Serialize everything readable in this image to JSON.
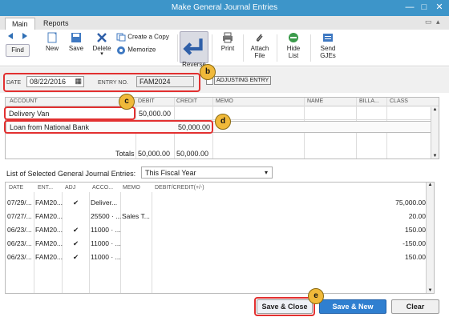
{
  "window": {
    "title": "Make General Journal Entries",
    "ctrl_min": "—",
    "ctrl_max": "□",
    "ctrl_close": "✕"
  },
  "tabs": [
    {
      "label": "Main"
    },
    {
      "label": "Reports"
    }
  ],
  "toolbar": {
    "find": "Find",
    "new": "New",
    "save": "Save",
    "delete": "Delete",
    "create_copy": "Create a Copy",
    "memorize": "Memorize",
    "reverse": "Reverse",
    "print": "Print",
    "attach_line1": "Attach",
    "attach_line2": "File",
    "hide_line1": "Hide",
    "hide_line2": "List",
    "send_line1": "Send",
    "send_line2": "GJEs"
  },
  "header": {
    "date_label": "DATE",
    "date_value": "08/22/2016",
    "entry_no_label": "ENTRY NO.",
    "entry_no_value": "FAM2024",
    "adjusting_label": "ADJUSTING ENTRY"
  },
  "callouts": {
    "b": "b",
    "c": "c",
    "d": "d",
    "e": "e"
  },
  "grid": {
    "columns": [
      "ACCOUNT",
      "DEBIT",
      "CREDIT",
      "MEMO",
      "NAME",
      "BILLA...",
      "CLASS"
    ],
    "rows": [
      {
        "account": "Delivery Van",
        "debit": "50,000.00",
        "credit": ""
      },
      {
        "account": "Loan from National Bank",
        "debit": "",
        "credit": "50,000.00"
      }
    ],
    "totals_label": "Totals",
    "total_debit": "50,000.00",
    "total_credit": "50,000.00"
  },
  "list": {
    "label": "List of Selected General Journal Entries:",
    "filter": "This Fiscal Year",
    "columns": [
      "DATE",
      "ENT...",
      "ADJ",
      "ACCO...",
      "MEMO",
      "DEBIT/CREDIT(+/-)"
    ],
    "rows": [
      {
        "date": "07/29/...",
        "ent": "FAM20...",
        "adj": "✔",
        "acct": "Deliver...",
        "memo": "",
        "amount": "75,000.00"
      },
      {
        "date": "07/27/...",
        "ent": "FAM20...",
        "adj": "",
        "acct": "25500 · ...",
        "memo": "Sales T...",
        "amount": "20.00"
      },
      {
        "date": "06/23/...",
        "ent": "FAM20...",
        "adj": "✔",
        "acct": "11000 · ...",
        "memo": "",
        "amount": "150.00"
      },
      {
        "date": "06/23/...",
        "ent": "FAM20...",
        "adj": "✔",
        "acct": "11000 · ...",
        "memo": "",
        "amount": "-150.00"
      },
      {
        "date": "06/23/...",
        "ent": "FAM20...",
        "adj": "✔",
        "acct": "11000 · ...",
        "memo": "",
        "amount": "150.00"
      }
    ]
  },
  "buttons": {
    "save_close": "Save & Close",
    "save_new": "Save & New",
    "clear": "Clear"
  },
  "colors": {
    "titlebar": "#3d95c9",
    "highlight": "#e23030",
    "callout": "#f0b93a",
    "primary": "#2f7fd0"
  }
}
